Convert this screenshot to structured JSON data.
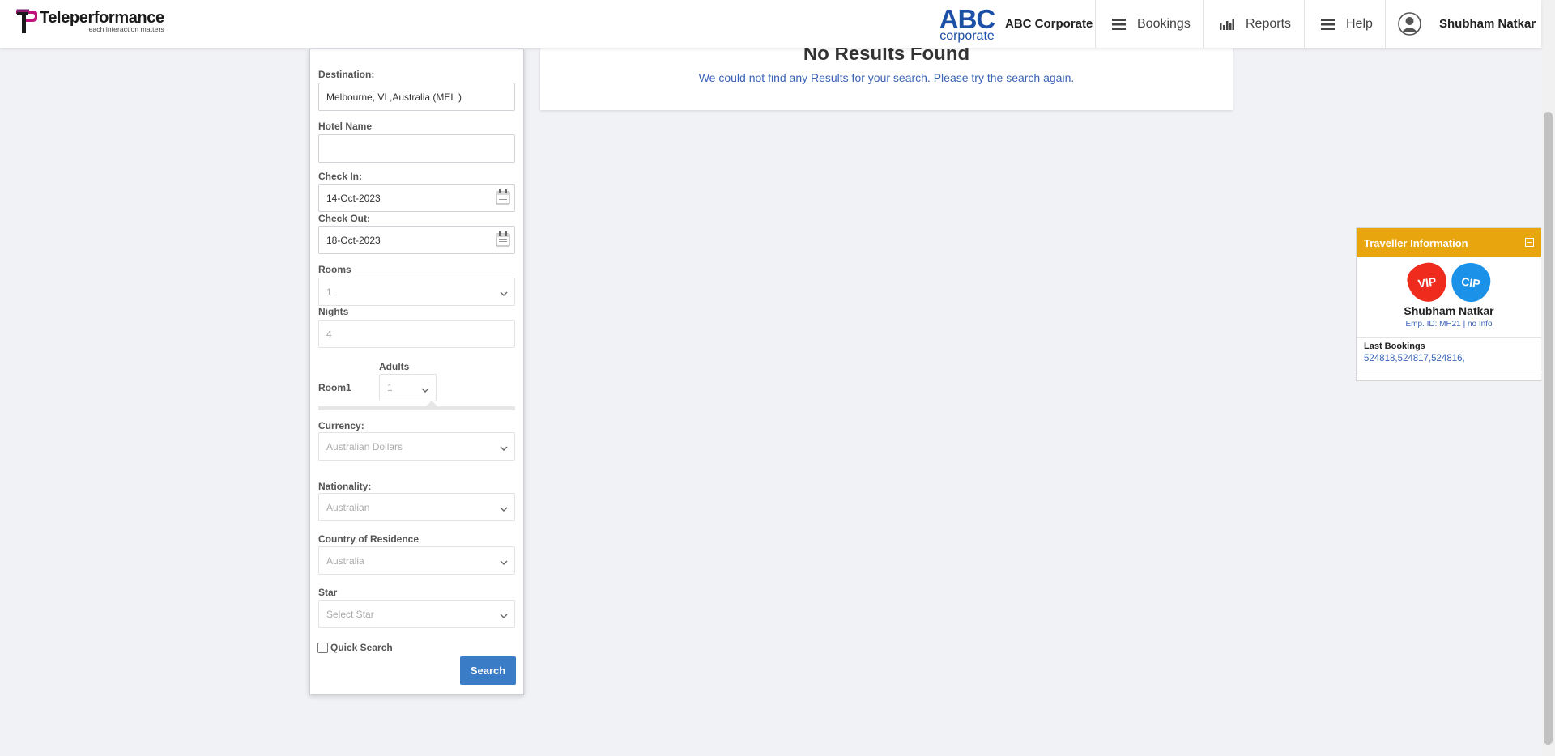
{
  "header": {
    "logo_name": "Teleperformance",
    "logo_tagline": "each interaction matters",
    "client_logo_big": "ABC",
    "client_logo_small": "corporate",
    "corporate_name": "ABC Corporate",
    "nav": {
      "bookings": "Bookings",
      "reports": "Reports",
      "help": "Help"
    },
    "user_name": "Shubham Natkar"
  },
  "search_panel": {
    "destination_label": "Destination:",
    "destination_value": "Melbourne, VI ,Australia (MEL )",
    "hotel_name_label": "Hotel Name",
    "hotel_name_value": "",
    "check_in_label": "Check In:",
    "check_in_value": "14-Oct-2023",
    "check_out_label": "Check Out:",
    "check_out_value": "18-Oct-2023",
    "rooms_label": "Rooms",
    "rooms_value": "1",
    "nights_label": "Nights",
    "nights_value": "4",
    "room1_label": "Room1",
    "adults_label": "Adults",
    "adults_value": "1",
    "currency_label": "Currency:",
    "currency_value": "Australian Dollars",
    "nationality_label": "Nationality:",
    "nationality_value": "Australian",
    "residence_label": "Country of Residence",
    "residence_value": "Australia",
    "star_label": "Star",
    "star_placeholder": "Select Star",
    "quick_search_label": "Quick Search",
    "quick_search_checked": false,
    "search_button": "Search"
  },
  "results": {
    "title": "No Results Found",
    "message": "We could not find any Results for your search. Please try the search again."
  },
  "traveller": {
    "heading": "Traveller Information",
    "badge_vip": "VIP",
    "badge_cip": "CIP",
    "name": "Shubham Natkar",
    "emp_info": "Emp. ID: MH21 | no Info",
    "last_bookings_label": "Last Bookings",
    "last_bookings_value": "524818,524817,524816,"
  },
  "colors": {
    "accent_blue": "#3a7cc5",
    "link_blue": "#3a63b6",
    "traveller_header": "#e9a50d",
    "vip_red": "#ee2b1d",
    "cip_blue": "#1b92e8",
    "brand_magenta": "#c1117a"
  },
  "icons": {
    "bookings": "menu-lines-icon",
    "reports": "bar-chart-icon",
    "help": "menu-lines-icon",
    "user": "user-avatar-icon",
    "calendar": "calendar-icon",
    "select": "chevron-down-icon"
  }
}
